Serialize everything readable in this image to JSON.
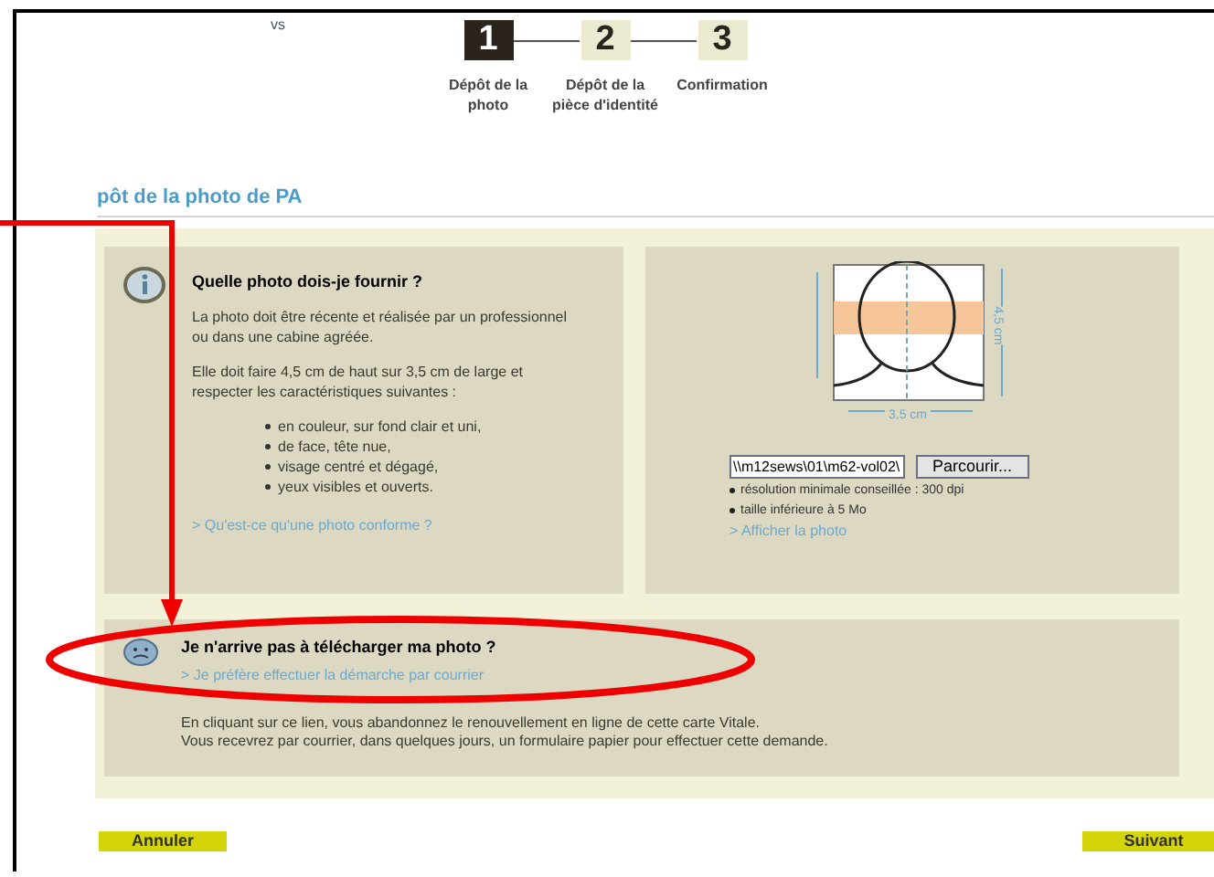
{
  "corner_mark": "vs",
  "steps": [
    {
      "number": "1",
      "label": "Dépôt de la photo",
      "selected": true
    },
    {
      "number": "2",
      "label": "Dépôt de la pièce d'identité",
      "selected": false
    },
    {
      "number": "3",
      "label": "Confirmation",
      "selected": false
    }
  ],
  "section_tab": "pôt de la photo de PA",
  "info_panel": {
    "title": "Quelle photo dois-je fournir ?",
    "paragraphs": [
      "La photo doit être récente et réalisée par un professionnel ou dans une cabine agréée.",
      "Elle doit faire 4,5 cm de haut sur 3,5 cm de large et respecter les caractéristiques suivantes :"
    ],
    "bullets": [
      "en couleur, sur fond clair et uni,",
      "de face, tête nue,",
      "visage centré et dégagé,",
      "yeux visibles et ouverts."
    ],
    "link": "> Qu'est-ce qu'une photo conforme ?"
  },
  "upload_panel": {
    "width_label": "3,5 cm",
    "height_label": "4,5 cm",
    "file_value": "\\\\m12sews\\01\\m62-vol02\\",
    "browse_button": "Parcourir...",
    "notes": [
      "résolution minimale conseillée : 300 dpi",
      "taille inférieure à 5 Mo"
    ],
    "link": "> Afficher la photo"
  },
  "help_panel": {
    "title": "Je n'arrive pas à télécharger ma photo ?",
    "link": "> Je préfère effectuer la démarche par courrier",
    "lines": [
      "En cliquant sur ce lien, vous abandonnez le renouvellement en ligne de cette carte Vitale.",
      "Vous recevrez par courrier, dans quelques jours, un formulaire papier pour effectuer cette demande."
    ]
  },
  "buttons": {
    "cancel": "Annuler",
    "next": "Suivant"
  }
}
